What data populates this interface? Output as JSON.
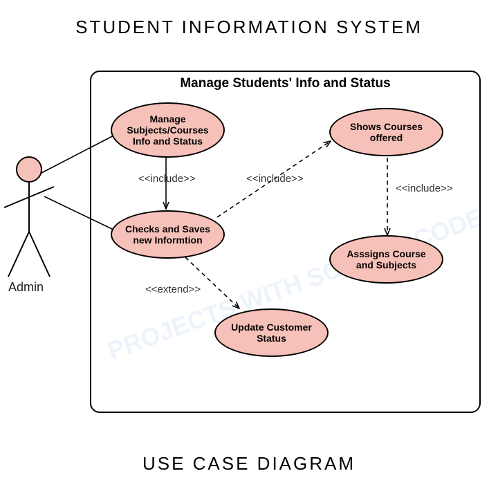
{
  "title": "STUDENT INFORMATION SYSTEM",
  "footer": "USE CASE DIAGRAM",
  "system_name": "Manage Students' Info and Status",
  "actor": {
    "name": "Admin"
  },
  "usecases": {
    "uc1": "Manage Subjects/Courses Info and Status",
    "uc2": "Checks and Saves new Informtion",
    "uc3": "Update Customer Status",
    "uc4": "Shows Courses offered",
    "uc5": "Asssigns Course and Subjects"
  },
  "relations": {
    "r1": "<<include>>",
    "r2": "<<extend>>",
    "r3": "<<include>>",
    "r4": "<<include>>"
  },
  "watermark": "PROJECTS WITH SOURCE CODE"
}
